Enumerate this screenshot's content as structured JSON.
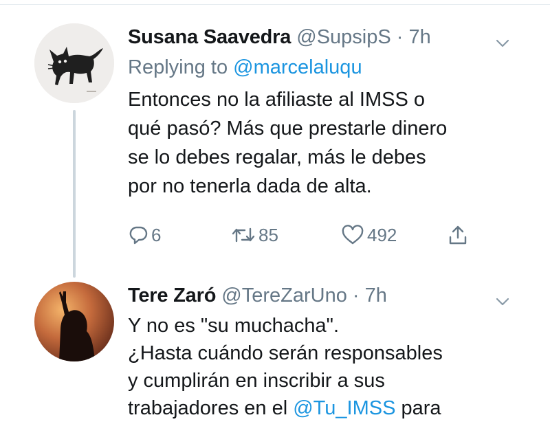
{
  "tweets": [
    {
      "name": "Susana Saavedra",
      "handle": "@SupsipS",
      "separator": "·",
      "time": "7h",
      "replying_prefix": "Replying to",
      "replying_to": "@marcelaluqu",
      "text_lines": [
        "Entonces no la afiliaste al IMSS o",
        "qué pasó? Más que prestarle dinero",
        "se lo debes regalar, más le debes",
        "por no tenerla dada de alta."
      ],
      "actions": {
        "replies": "6",
        "retweets": "85",
        "likes": "492"
      },
      "avatar_icon": "black-cat-drawing"
    },
    {
      "name": "Tere Zaró",
      "handle": "@TereZarUno",
      "separator": "·",
      "time": "7h",
      "text_lines": [
        "Y no es \"su muchacha\".",
        "¿Hasta cuándo serán responsables",
        "y cumplirán en inscribir a sus"
      ],
      "last_line_prefix": "trabajadores en el",
      "mention": "@Tu_IMSS",
      "last_line_suffix": "para",
      "avatar_icon": "sunset-silhouette-photo"
    }
  ],
  "colors": {
    "link": "#1b95e0",
    "secondary_text": "#657786",
    "thread_line": "#ccd6dd"
  },
  "icons": [
    "reply-icon",
    "retweet-icon",
    "like-icon",
    "share-icon",
    "chevron-down-icon"
  ]
}
